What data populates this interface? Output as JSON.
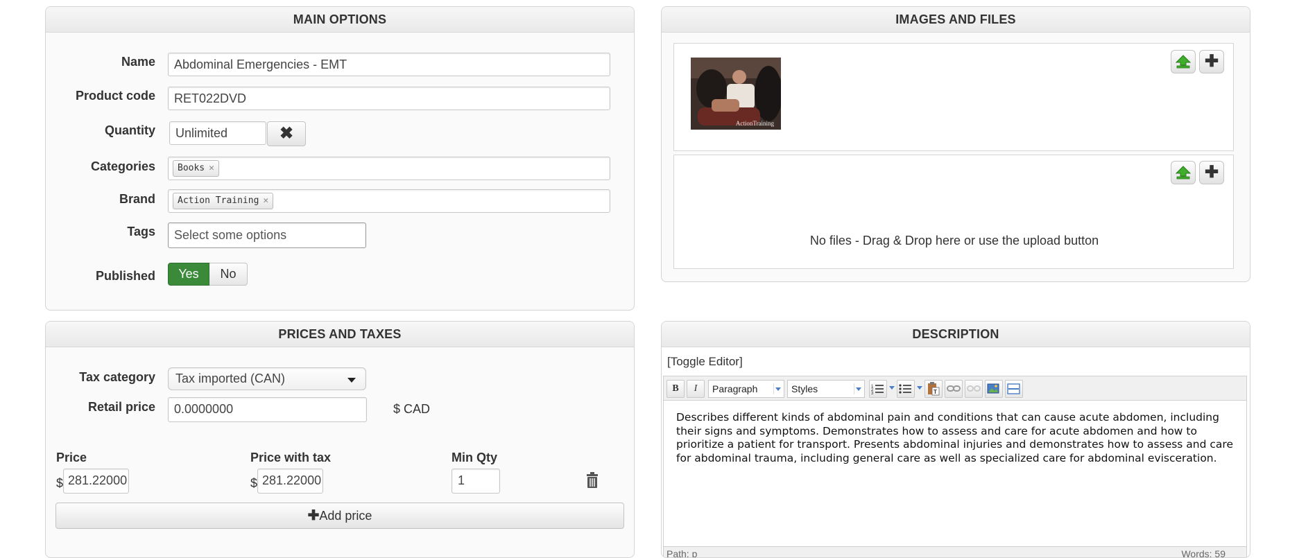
{
  "main_options": {
    "title": "MAIN OPTIONS",
    "name_label": "Name",
    "name_value": "Abdominal Emergencies - EMT",
    "product_code_label": "Product code",
    "product_code_value": "RET022DVD",
    "quantity_label": "Quantity",
    "quantity_value": "Unlimited",
    "categories_label": "Categories",
    "categories": [
      "Books"
    ],
    "brand_label": "Brand",
    "brands": [
      "Action Training"
    ],
    "tags_label": "Tags",
    "tags_placeholder": "Select some options",
    "published_label": "Published",
    "published_yes": "Yes",
    "published_no": "No",
    "published_selected": "Yes"
  },
  "images_files": {
    "title": "IMAGES AND FILES",
    "image_watermark": "ActionTraining",
    "no_files_text": "No files - Drag & Drop here or use the upload button"
  },
  "prices_taxes": {
    "title": "PRICES AND TAXES",
    "tax_category_label": "Tax category",
    "tax_category_value": "Tax imported (CAN)",
    "retail_price_label": "Retail price",
    "retail_price_value": "0.0000000",
    "currency": "$ CAD",
    "price_label": "Price",
    "price_with_tax_label": "Price with tax",
    "min_qty_label": "Min Qty",
    "dollar": "$",
    "price_value": "281.22000",
    "price_with_tax_value": "281.22000",
    "min_qty_value": "1",
    "add_price_label": "Add price"
  },
  "description": {
    "title": "DESCRIPTION",
    "toggle_editor": "[Toggle Editor]",
    "format_select": "Paragraph",
    "styles_select": "Styles",
    "body_text": "Describes different kinds of abdominal pain and conditions that can cause acute abdomen, including their signs and symptoms. Demonstrates how to assess and care for acute abdomen and how to prioritize a patient for transport. Presents abdominal injuries and demonstrates how to assess and care for abdominal trauma, including general care as well as specialized care for abdominal evisceration.",
    "path_label": "Path: p",
    "words_label": "Words: 59"
  },
  "colors": {
    "published_yes_bg": "#3a8a3a",
    "upload_icon": "#3fae2a"
  }
}
